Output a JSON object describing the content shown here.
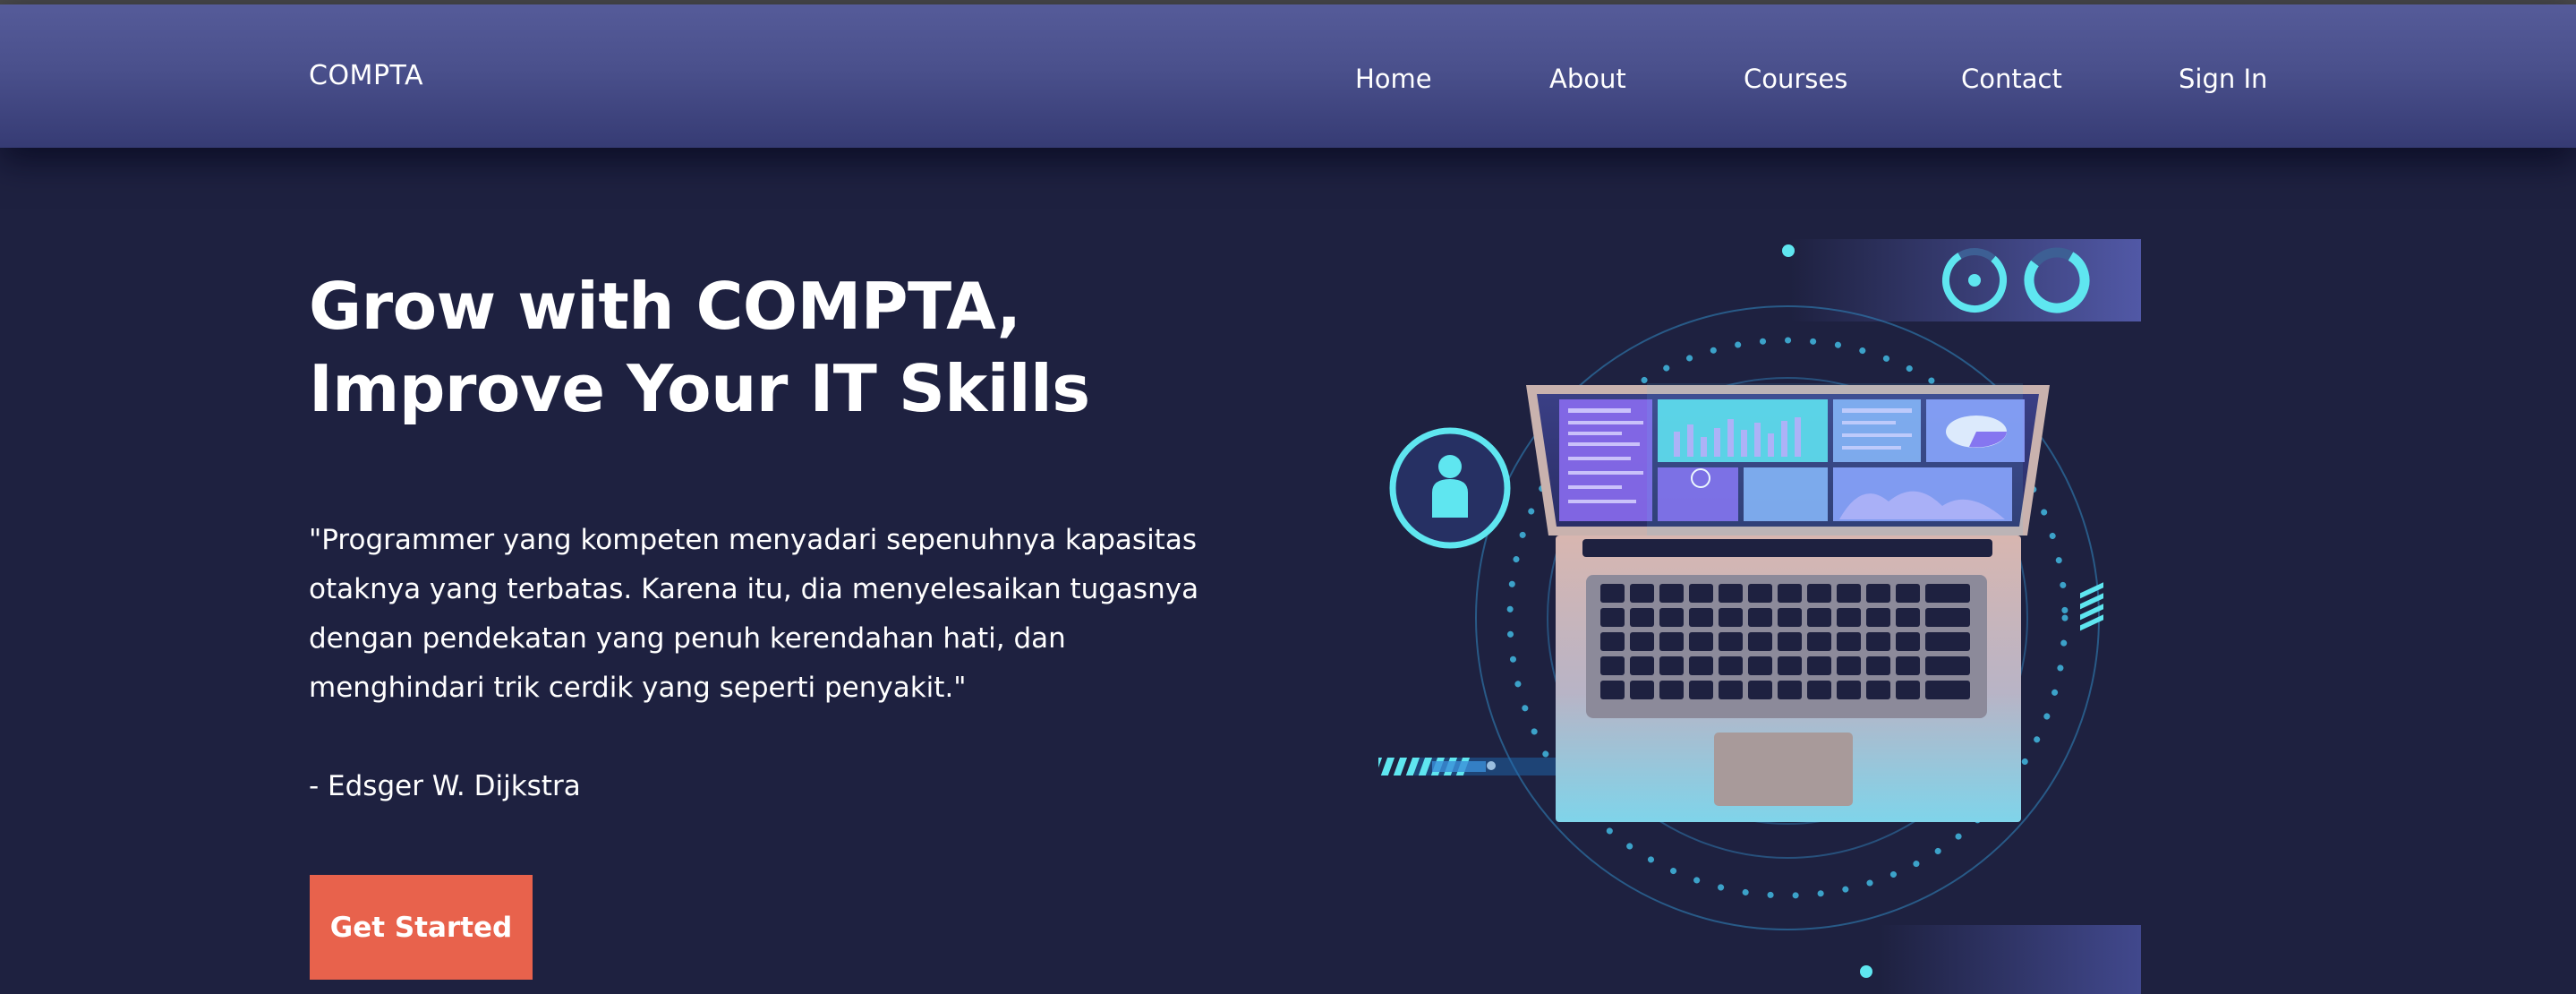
{
  "brand": "COMPTA",
  "nav": {
    "links": [
      {
        "label": "Home"
      },
      {
        "label": "About"
      },
      {
        "label": "Courses"
      },
      {
        "label": "Contact"
      },
      {
        "label": "Sign In"
      }
    ]
  },
  "hero": {
    "title_lines": [
      "Grow with COMPTA,",
      "Improve Your IT Skills"
    ],
    "quote_lines": [
      "\"Programmer yang kompeten menyadari sepenuhnya kapasitas",
      "otaknya yang terbatas. Karena itu, dia menyelesaikan tugasnya",
      "dengan pendekatan yang penuh kerendahan hati, dan",
      "menghindari trik cerdik yang seperti penyakit.\""
    ],
    "author": "- Edsger W. Dijkstra",
    "cta_label": "Get Started"
  },
  "colors": {
    "background": "#1e2140",
    "navbar": "#4a508c",
    "cta": "#e8624c",
    "accent_cyan": "#5fe6f0",
    "accent_purple": "#8a6cf0"
  },
  "illustration": {
    "icons": [
      "user-icon",
      "ring-icon",
      "donut-icon",
      "laptop-icon"
    ]
  }
}
